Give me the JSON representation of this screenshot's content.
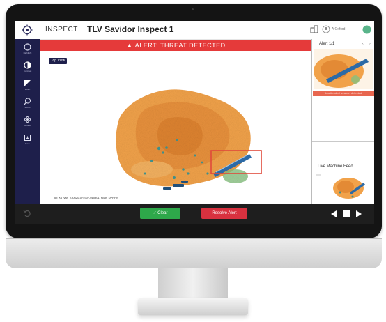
{
  "app": {
    "name": "INSPECT",
    "lane_title": "TLV Savidor Inspect 1",
    "user_name": "A Oxford"
  },
  "alert": {
    "banner_text": "ALERT: THREAT DETECTED"
  },
  "sidebar": {
    "tools": [
      {
        "label": "Highlight",
        "icon": "highlight-icon"
      },
      {
        "label": "Contrast",
        "icon": "contrast-icon"
      },
      {
        "label": "Invert",
        "icon": "invert-icon"
      },
      {
        "label": "Zoom",
        "icon": "zoom-icon"
      },
      {
        "label": "Rotate",
        "icon": "rotate-icon"
      },
      {
        "label": "Save",
        "icon": "save-icon"
      }
    ]
  },
  "viewer": {
    "view_label": "Top View",
    "scan_id": "ID: Xu Ivan_230620-074907-010901_scan_DPRHN"
  },
  "right_panel": {
    "alert_title": "Alert 1/1",
    "alert_strip_text": "Unattended weapon detected",
    "live_title": "Live Machine Feed"
  },
  "bottom": {
    "clear_label": "Clear",
    "resolve_label": "Resolve Alert"
  },
  "colors": {
    "sidebar": "#1e1f4b",
    "alert": "#e53a3a",
    "clear": "#2ea84a",
    "resolve": "#d8313f",
    "bottom_bar": "#1e1e1e"
  }
}
